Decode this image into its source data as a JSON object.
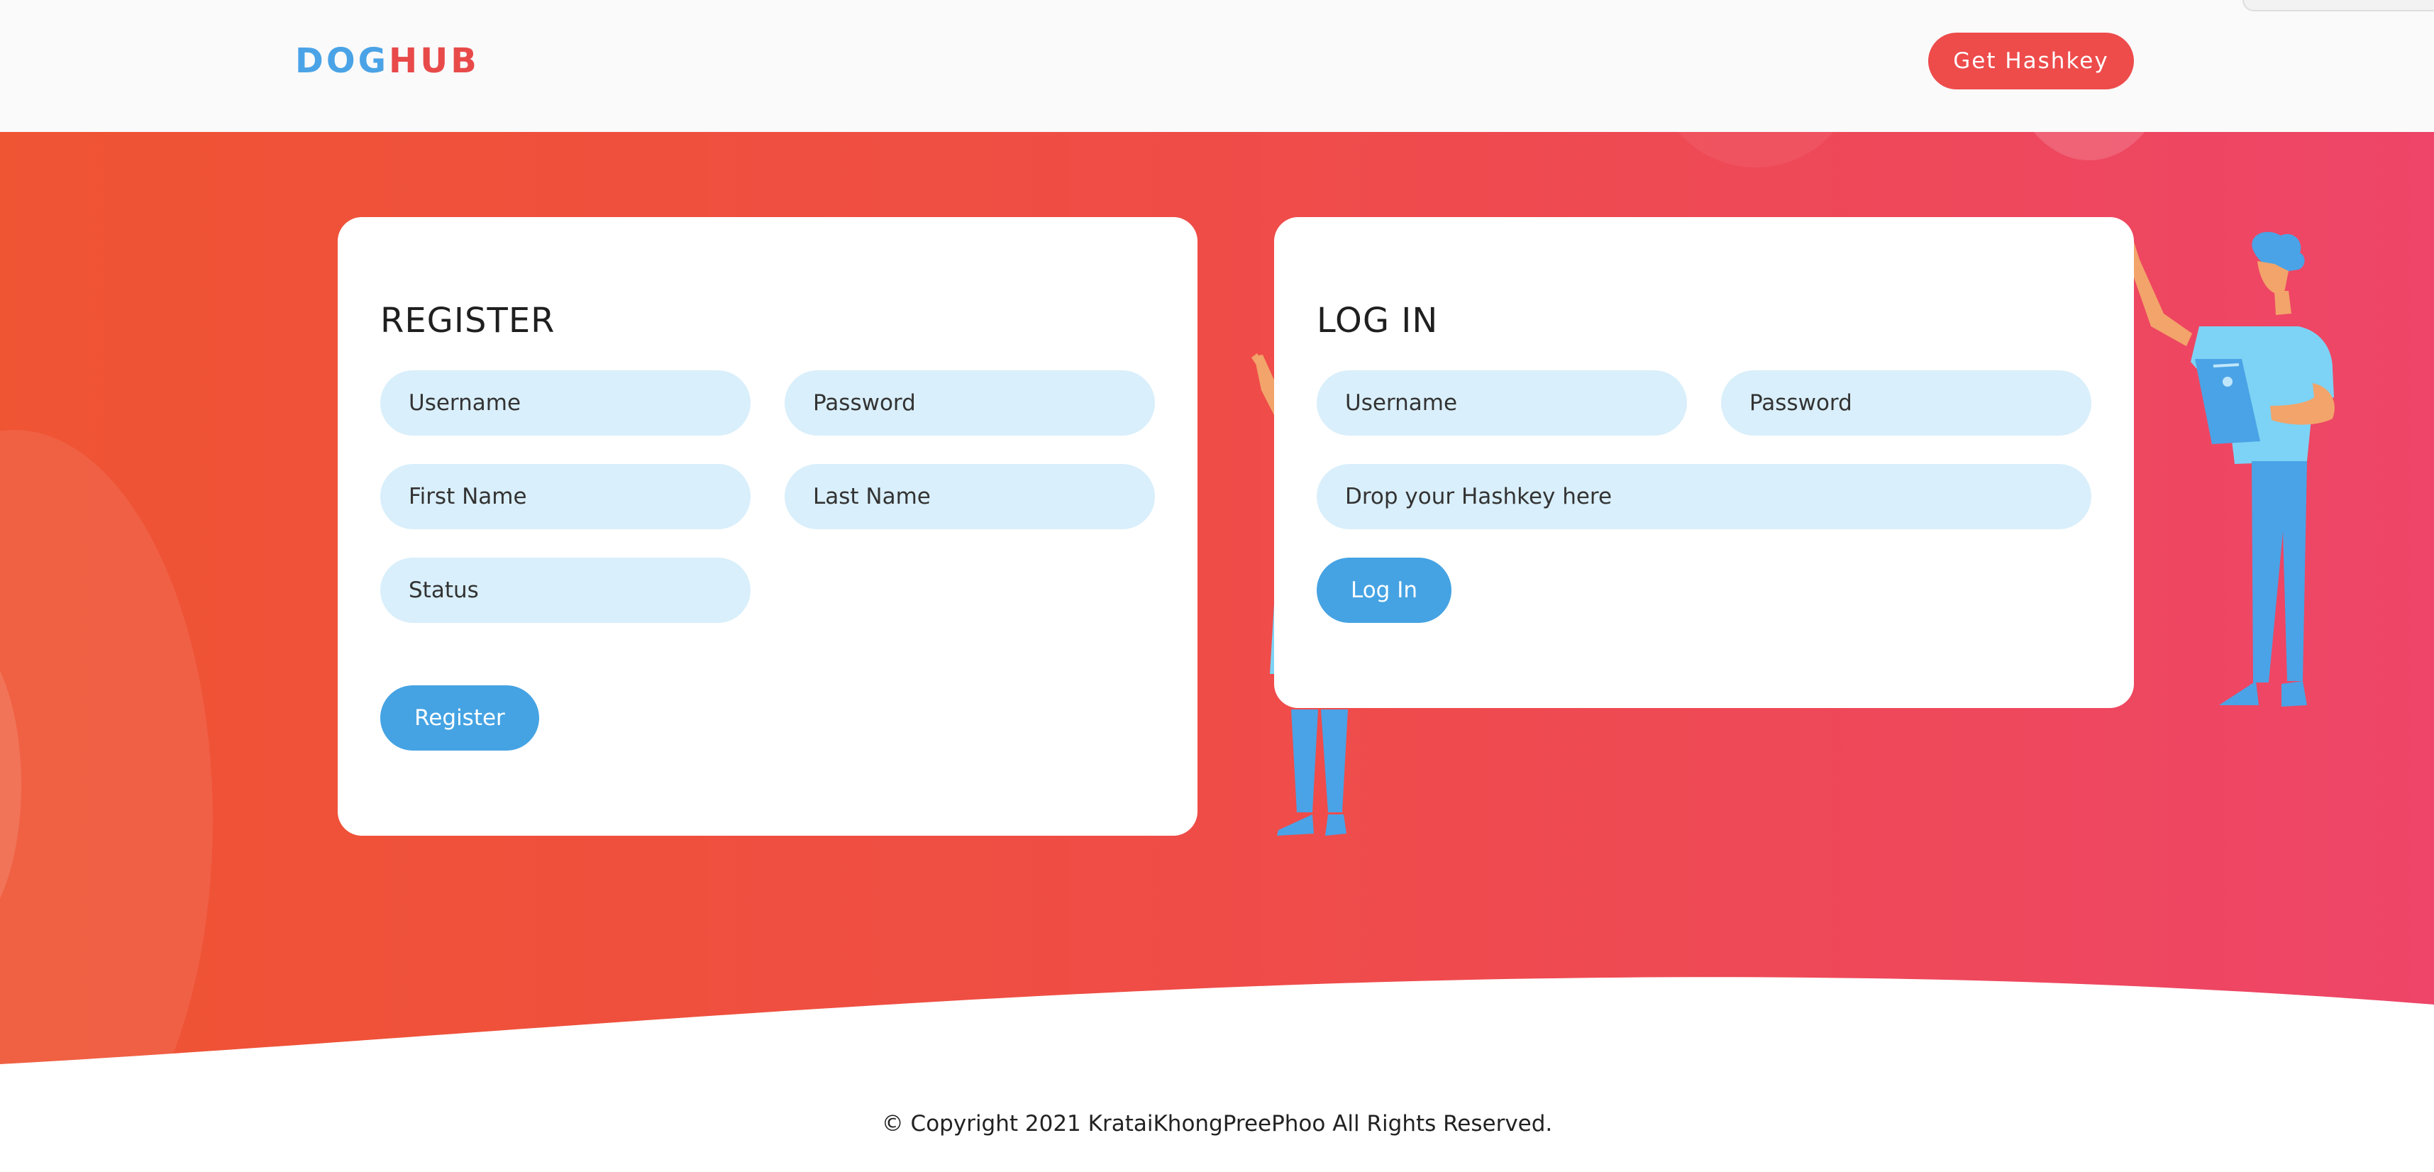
{
  "header": {
    "logo_dog": "DOG",
    "logo_hub": "HUB",
    "get_hashkey_label": "Get Hashkey"
  },
  "register": {
    "title": "REGISTER",
    "username_placeholder": "Username",
    "password_placeholder": "Password",
    "first_name_placeholder": "First Name",
    "last_name_placeholder": "Last Name",
    "status_placeholder": "Status",
    "button_label": "Register"
  },
  "login": {
    "title": "LOG IN",
    "username_placeholder": "Username",
    "password_placeholder": "Password",
    "hashkey_placeholder": "Drop your Hashkey here",
    "button_label": "Log In"
  },
  "footer": {
    "copyright": "© Copyright 2021 KrataiKhongPreePhoo All Rights Reserved."
  },
  "colors": {
    "brand_blue": "#4aa3e6",
    "brand_red": "#e84a4a",
    "button_blue": "#45a3e3",
    "input_bg": "#d9effb",
    "gradient_start": "#ef5433",
    "gradient_end": "#ee4568"
  }
}
